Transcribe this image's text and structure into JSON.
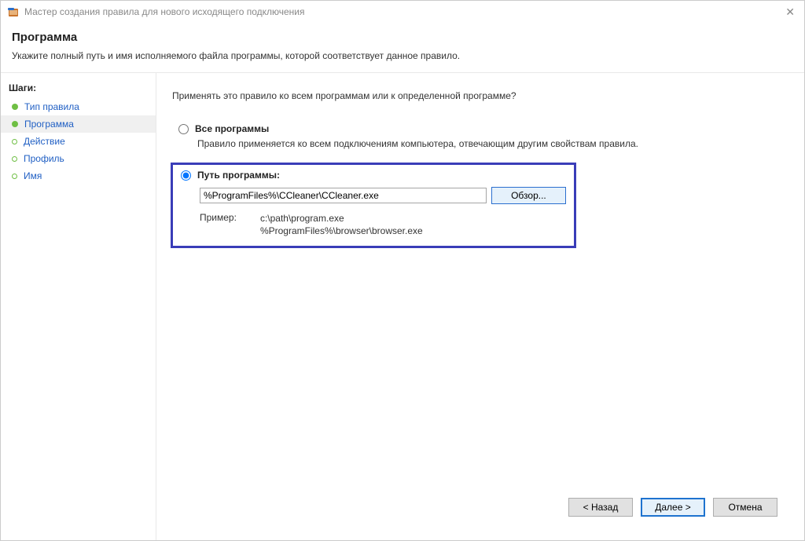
{
  "window": {
    "title": "Мастер создания правила для нового исходящего подключения"
  },
  "header": {
    "title": "Программа",
    "subtitle": "Укажите полный путь и имя исполняемого файла программы, которой соответствует данное правило."
  },
  "sidebar": {
    "heading": "Шаги:",
    "steps": [
      {
        "label": "Тип правила",
        "active": false,
        "done": true
      },
      {
        "label": "Программа",
        "active": true,
        "done": true
      },
      {
        "label": "Действие",
        "active": false,
        "done": false
      },
      {
        "label": "Профиль",
        "active": false,
        "done": false
      },
      {
        "label": "Имя",
        "active": false,
        "done": false
      }
    ]
  },
  "main": {
    "question": "Применять это правило ко всем программам или к определенной программе?",
    "option_all": {
      "label": "Все программы",
      "desc": "Правило применяется ко всем подключениям компьютера, отвечающим другим свойствам правила."
    },
    "option_path": {
      "label": "Путь программы:",
      "value": "%ProgramFiles%\\CCleaner\\CCleaner.exe",
      "browse": "Обзор...",
      "example_label": "Пример:",
      "example1": "c:\\path\\program.exe",
      "example2": "%ProgramFiles%\\browser\\browser.exe"
    }
  },
  "buttons": {
    "back": "< Назад",
    "next": "Далее >",
    "cancel": "Отмена"
  }
}
